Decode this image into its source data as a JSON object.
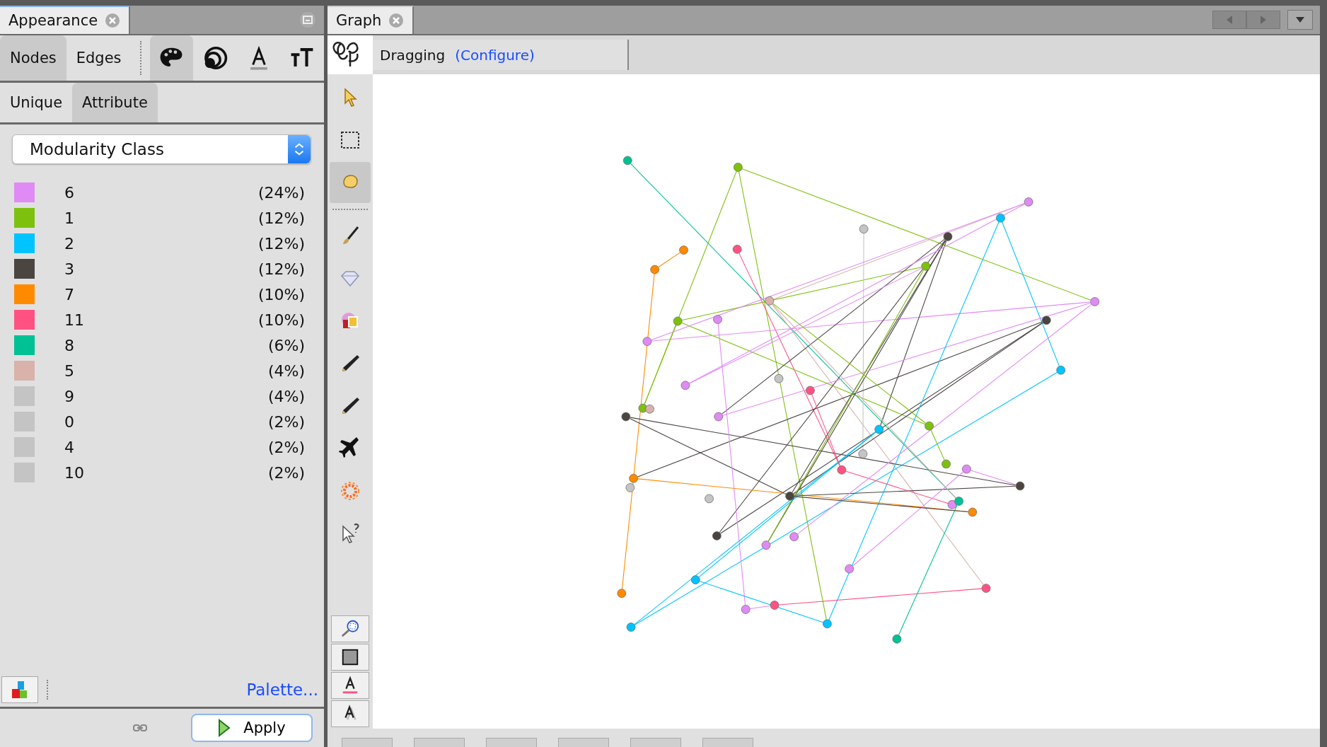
{
  "appearance_panel": {
    "tab": {
      "label": "Appearance"
    },
    "element_tabs": [
      {
        "label": "Nodes",
        "selected": true
      },
      {
        "label": "Edges",
        "selected": false
      }
    ],
    "property_tabs": [
      {
        "kind": "color",
        "selected": true
      },
      {
        "kind": "size",
        "selected": false
      },
      {
        "kind": "label-color",
        "selected": false
      },
      {
        "kind": "label-size",
        "selected": false
      }
    ],
    "mode_tabs": [
      {
        "label": "Unique",
        "selected": false
      },
      {
        "label": "Attribute",
        "selected": true
      }
    ],
    "attribute": {
      "value": "Modularity Class"
    },
    "partition": [
      {
        "label": "6",
        "share": "(24%)",
        "color": "#e08af5"
      },
      {
        "label": "1",
        "share": "(12%)",
        "color": "#7dc10e"
      },
      {
        "label": "2",
        "share": "(12%)",
        "color": "#00c3ff"
      },
      {
        "label": "3",
        "share": "(12%)",
        "color": "#4b4541"
      },
      {
        "label": "7",
        "share": "(10%)",
        "color": "#ff8a00"
      },
      {
        "label": "11",
        "share": "(10%)",
        "color": "#ff5283"
      },
      {
        "label": "8",
        "share": "(6%)",
        "color": "#00c194"
      },
      {
        "label": "5",
        "share": "(4%)",
        "color": "#d9b2ab"
      },
      {
        "label": "9",
        "share": "(4%)",
        "color": "#c4c4c4"
      },
      {
        "label": "0",
        "share": "(2%)",
        "color": "#c4c4c4"
      },
      {
        "label": "4",
        "share": "(2%)",
        "color": "#c4c4c4"
      },
      {
        "label": "10",
        "share": "(2%)",
        "color": "#c4c4c4"
      }
    ],
    "palette_link": "Palette...",
    "apply_button": "Apply"
  },
  "graph_panel": {
    "tab": {
      "label": "Graph"
    },
    "tool": "Dragging",
    "configure_link": "(Configure)",
    "tools": [
      {
        "kind": "select",
        "selected": false
      },
      {
        "kind": "rect",
        "selected": false
      },
      {
        "kind": "hand",
        "selected": true
      },
      {
        "kind": "divider"
      },
      {
        "kind": "brush",
        "selected": false
      },
      {
        "kind": "diamond",
        "selected": false
      },
      {
        "kind": "painter",
        "selected": false
      },
      {
        "kind": "pencil",
        "selected": false
      },
      {
        "kind": "pencil",
        "selected": false
      },
      {
        "kind": "plane",
        "selected": false
      },
      {
        "kind": "flower",
        "selected": false
      },
      {
        "kind": "help",
        "selected": false
      }
    ],
    "view_buttons": [
      {
        "kind": "zoom"
      },
      {
        "kind": "background"
      },
      {
        "kind": "label-color"
      },
      {
        "kind": "label-shadow"
      }
    ]
  }
}
